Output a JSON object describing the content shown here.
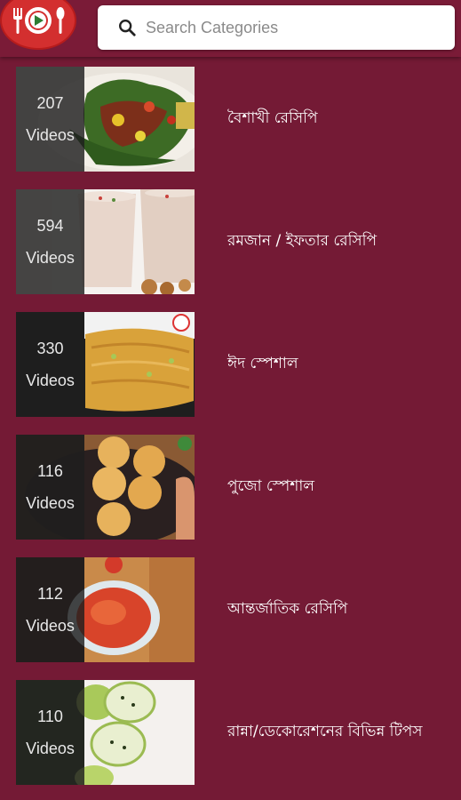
{
  "header": {
    "logo_icon": "plate-fork-spoon-play-icon",
    "search": {
      "placeholder": "Search Categories",
      "value": ""
    }
  },
  "categories": [
    {
      "count": "207",
      "unit": "Videos",
      "title": "বৈশাখী রেসিপি",
      "thumb_icon": "capsicum-curry-image"
    },
    {
      "count": "594",
      "unit": "Videos",
      "title": "রমজান / ইফতার রেসিপি",
      "thumb_icon": "lassi-drinks-image"
    },
    {
      "count": "330",
      "unit": "Videos",
      "title": "ঈদ স্পেশাল",
      "thumb_icon": "vermicelli-sweet-image"
    },
    {
      "count": "116",
      "unit": "Videos",
      "title": "পুজো স্পেশাল",
      "thumb_icon": "modak-sweets-image"
    },
    {
      "count": "112",
      "unit": "Videos",
      "title": "আন্তর্জাতিক রেসিপি",
      "thumb_icon": "tomato-sauce-bowl-image"
    },
    {
      "count": "110",
      "unit": "Videos",
      "title": "রান্না/ডেকোরেশনের বিভিন্ন টিপস",
      "thumb_icon": "lemon-cloves-tip-image"
    }
  ],
  "colors": {
    "background": "#741a35",
    "header": "#7a1b37",
    "logo": "#d32f2f",
    "count_overlay": "#1e1e1e"
  }
}
